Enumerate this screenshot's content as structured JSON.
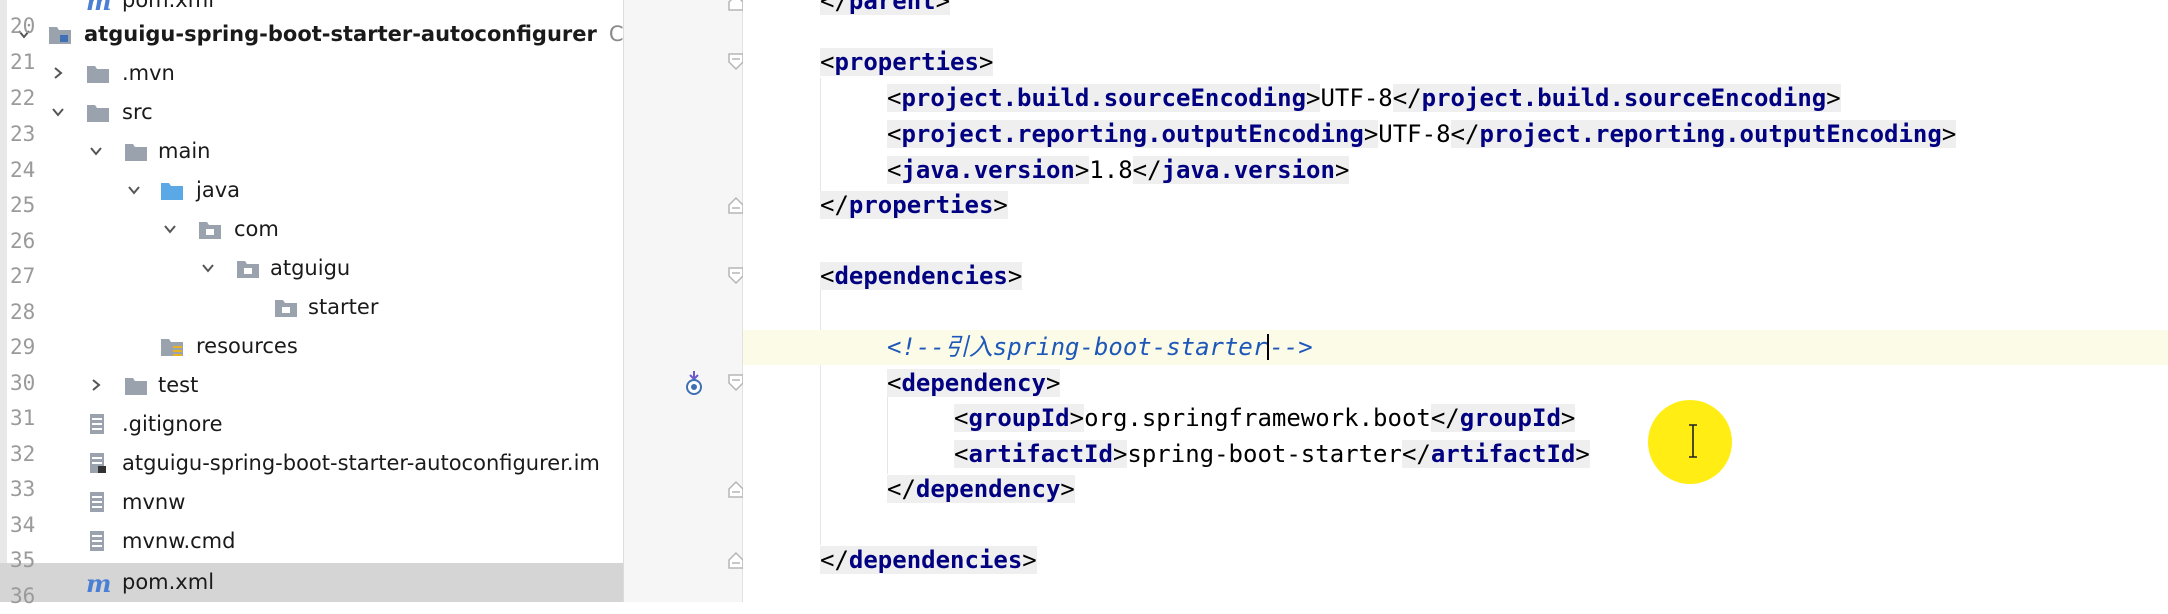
{
  "project_tree": {
    "partial_top_item": "pom.xml",
    "module_name": "atguigu-spring-boot-starter-autoconfigurer",
    "module_path_suffix": "C:",
    "items": [
      {
        "label": ".mvn",
        "kind": "folder"
      },
      {
        "label": "src",
        "kind": "folder"
      },
      {
        "label": "main",
        "kind": "folder"
      },
      {
        "label": "java",
        "kind": "source-folder"
      },
      {
        "label": "com",
        "kind": "package"
      },
      {
        "label": "atguigu",
        "kind": "package"
      },
      {
        "label": "starter",
        "kind": "package"
      },
      {
        "label": "resources",
        "kind": "resources-folder"
      },
      {
        "label": "test",
        "kind": "folder"
      },
      {
        "label": ".gitignore",
        "kind": "file"
      },
      {
        "label": "atguigu-spring-boot-starter-autoconfigurer.im",
        "kind": "iml-file"
      },
      {
        "label": "mvnw",
        "kind": "file"
      },
      {
        "label": "mvnw.cmd",
        "kind": "file"
      },
      {
        "label": "pom.xml",
        "kind": "maven-file",
        "selected": true
      }
    ]
  },
  "editor": {
    "line_numbers": [
      "20",
      "21",
      "22",
      "23",
      "24",
      "25",
      "26",
      "27",
      "28",
      "29",
      "30",
      "31",
      "32",
      "33",
      "34",
      "35",
      "36"
    ],
    "current_line": "29",
    "partial_top_tag": "</parent>",
    "lines": {
      "l21_tag": "properties",
      "l22_tag": "project.build.sourceEncoding",
      "l22_value": "UTF-8",
      "l23_tag": "project.reporting.outputEncoding",
      "l23_value": "UTF-8",
      "l24_tag": "java.version",
      "l24_value": "1.8",
      "l25_tag": "properties",
      "l27_tag": "dependencies",
      "l29_comment_open": "<!--",
      "l29_comment_text": "引入spring-boot-starter",
      "l29_comment_close": "-->",
      "l30_tag": "dependency",
      "l31_tag": "groupId",
      "l31_value": "org.springframework.boot",
      "l32_tag": "artifactId",
      "l32_value": "spring-boot-starter",
      "l33_tag": "dependency",
      "l35_tag": "dependencies"
    }
  },
  "colors": {
    "tag": "#000080",
    "comment": "#1d57b8",
    "cursor_highlight": "#ffec00",
    "selection": "#d5d5d5"
  }
}
